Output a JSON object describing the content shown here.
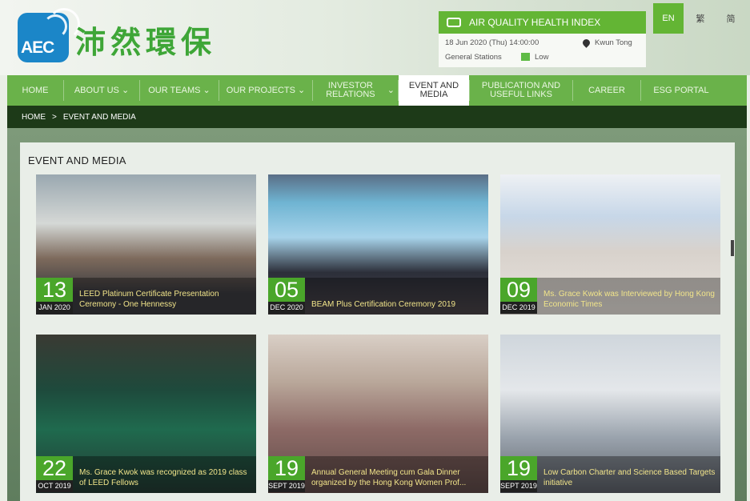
{
  "header": {
    "logo_text": "AEC",
    "logo_cn": "沛然環保"
  },
  "aqhi": {
    "title": "AIR QUALITY HEALTH INDEX",
    "datetime": "18 Jun 2020 (Thu) 14:00:00",
    "location": "Kwun Tong",
    "stations": "General Stations",
    "level": "Low",
    "level_color": "#5fbb46"
  },
  "languages": [
    "EN",
    "繁",
    "简"
  ],
  "nav": [
    {
      "label": "HOME",
      "chevron": false
    },
    {
      "label": "ABOUT US",
      "chevron": true
    },
    {
      "label": "OUR TEAMS",
      "chevron": true
    },
    {
      "label": "OUR PROJECTS",
      "chevron": true
    },
    {
      "label": "INVESTOR RELATIONS",
      "chevron": true
    },
    {
      "label": "EVENT AND MEDIA",
      "chevron": false,
      "active": true
    },
    {
      "label": "PUBLICATION AND USEFUL LINKS",
      "chevron": false
    },
    {
      "label": "CAREER",
      "chevron": false
    },
    {
      "label": "ESG PORTAL",
      "chevron": false
    }
  ],
  "breadcrumb": {
    "home": "HOME",
    "sep": ">",
    "current": "EVENT AND MEDIA"
  },
  "section_title": "EVENT AND MEDIA",
  "cards": [
    {
      "day": "13",
      "month": "JAN 2020",
      "caption": "LEED Platinum Certificate Presentation Ceremony - One Hennessy"
    },
    {
      "day": "05",
      "month": "DEC 2020",
      "caption": "BEAM Plus Certification Ceremony 2019"
    },
    {
      "day": "09",
      "month": "DEC 2019",
      "caption": "Ms. Grace Kwok was Interviewed by Hong Kong Economic Times"
    },
    {
      "day": "22",
      "month": "OCT 2019",
      "caption": "Ms. Grace Kwok was recognized as 2019 class of LEED Fellows"
    },
    {
      "day": "19",
      "month": "SEPT 2019",
      "caption": "Annual General Meeting cum Gala Dinner organized by the Hong Kong Women Prof..."
    },
    {
      "day": "19",
      "month": "SEPT 2019",
      "caption": "Low Carbon Charter and Science Based Targets initiative"
    }
  ],
  "colors": {
    "accent": "#63b534",
    "nav": "#6ab24a",
    "crumb_bg": "#1d3a18",
    "caption": "#f1e48a"
  }
}
